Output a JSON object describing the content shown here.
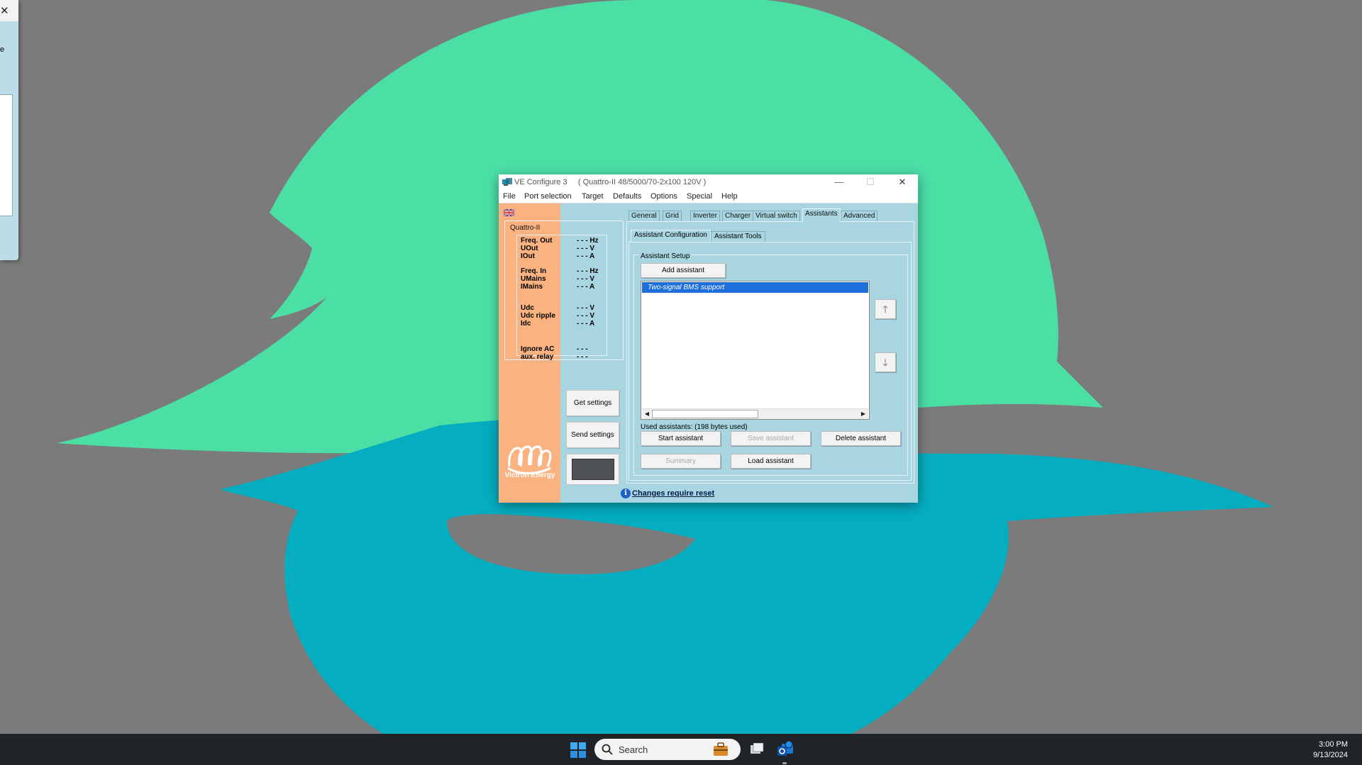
{
  "left_window": {
    "close_glyph": "✕",
    "fragment": "e"
  },
  "window": {
    "title": "VE Configure 3     ( Quattro-II 48/5000/70-2x100 120V )",
    "controls": {
      "minimize": "—",
      "maximize": "☐",
      "close": "✕"
    },
    "menu": [
      "File",
      "Port selection",
      "Target",
      "Defaults",
      "Options",
      "Special",
      "Help"
    ]
  },
  "device_panel": {
    "group_label": "Quattro-II",
    "readings": [
      {
        "label": "Freq. Out",
        "value": "- - - Hz"
      },
      {
        "label": "UOut",
        "value": "- - - V"
      },
      {
        "label": "IOut",
        "value": "- - - A"
      },
      {
        "label": "Freq. In",
        "value": "- - - Hz"
      },
      {
        "label": "UMains",
        "value": "- - - V"
      },
      {
        "label": "IMains",
        "value": "- - - A"
      },
      {
        "label": "Udc",
        "value": "- - - V"
      },
      {
        "label": "Udc ripple",
        "value": "- - - V"
      },
      {
        "label": "Idc",
        "value": "- - - A"
      },
      {
        "label": "Ignore AC",
        "value": "- - -"
      },
      {
        "label": "aux. relay",
        "value": "- - -"
      }
    ],
    "get_settings_label": "Get settings",
    "send_settings_label": "Send settings",
    "logo_text": "Victron Energy"
  },
  "tabs": [
    "General",
    "Grid",
    "Inverter",
    "Charger",
    "Virtual switch",
    "Assistants",
    "Advanced"
  ],
  "active_tab": "Assistants",
  "subtabs": [
    "Assistant Configuration",
    "Assistant Tools"
  ],
  "assistant_setup": {
    "group_label": "Assistant Setup",
    "add_button": "Add assistant",
    "list_items": [
      "Two-signal BMS support"
    ],
    "used_text": "Used assistants: (198 bytes used)",
    "start_button": "Start assistant",
    "save_button": "Save assistant",
    "delete_button": "Delete assistant",
    "summary_button": "Summary",
    "load_button": "Load assistant",
    "move_up_glyph": "🡑",
    "move_down_glyph": "🡓",
    "scroll_left_glyph": "◀",
    "scroll_right_glyph": "▶"
  },
  "status": {
    "text": "Changes require reset",
    "info_glyph": "i"
  },
  "taskbar": {
    "search_placeholder": "Search",
    "time": "3:00 PM",
    "date": "9/13/2024"
  },
  "colors": {
    "wallpaper_bg": "#7b7b7b",
    "wallpaper_green": "#4bdfa6",
    "wallpaper_teal": "#05adc0",
    "window_bg": "#a9d5e1",
    "orange_strip": "#f9b280",
    "selection": "#1e6fd9"
  }
}
